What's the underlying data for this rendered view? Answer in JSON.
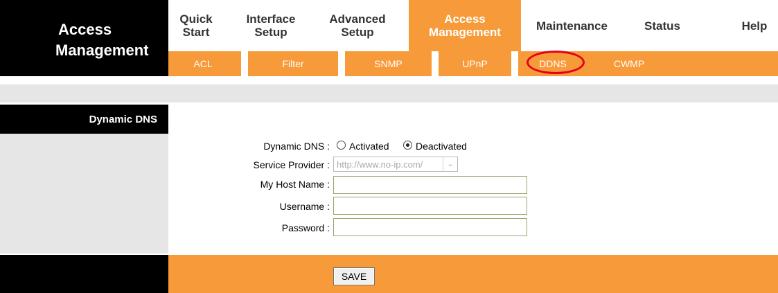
{
  "header": {
    "logo_line1": "Access",
    "logo_line2": "Management"
  },
  "nav": {
    "items": [
      {
        "line1": "Quick",
        "line2": "Start"
      },
      {
        "line1": "Interface",
        "line2": "Setup"
      },
      {
        "line1": "Advanced",
        "line2": "Setup"
      },
      {
        "line1": "Access",
        "line2": "Management",
        "active": true
      },
      {
        "line1": "Maintenance",
        "line2": ""
      },
      {
        "line1": "Status",
        "line2": ""
      },
      {
        "line1": "Help",
        "line2": ""
      }
    ]
  },
  "subnav": {
    "items": [
      "ACL",
      "Filter",
      "SNMP",
      "UPnP",
      "DDNS",
      "CWMP"
    ],
    "selected": "DDNS"
  },
  "section": {
    "title": "Dynamic DNS"
  },
  "form": {
    "dynamic_dns_label": "Dynamic DNS :",
    "activated_label": "Activated",
    "deactivated_label": "Deactivated",
    "selected_option": "Deactivated",
    "service_provider_label": "Service Provider :",
    "service_provider_value": "http://www.no-ip.com/",
    "host_name_label": "My Host Name :",
    "host_name_value": "",
    "username_label": "Username :",
    "username_value": "",
    "password_label": "Password :",
    "password_value": ""
  },
  "footer": {
    "save_label": "SAVE"
  },
  "colors": {
    "accent": "#f79a3a",
    "dark": "#000000",
    "gray": "#e6e6e6",
    "highlight_ring": "#e3001b"
  }
}
